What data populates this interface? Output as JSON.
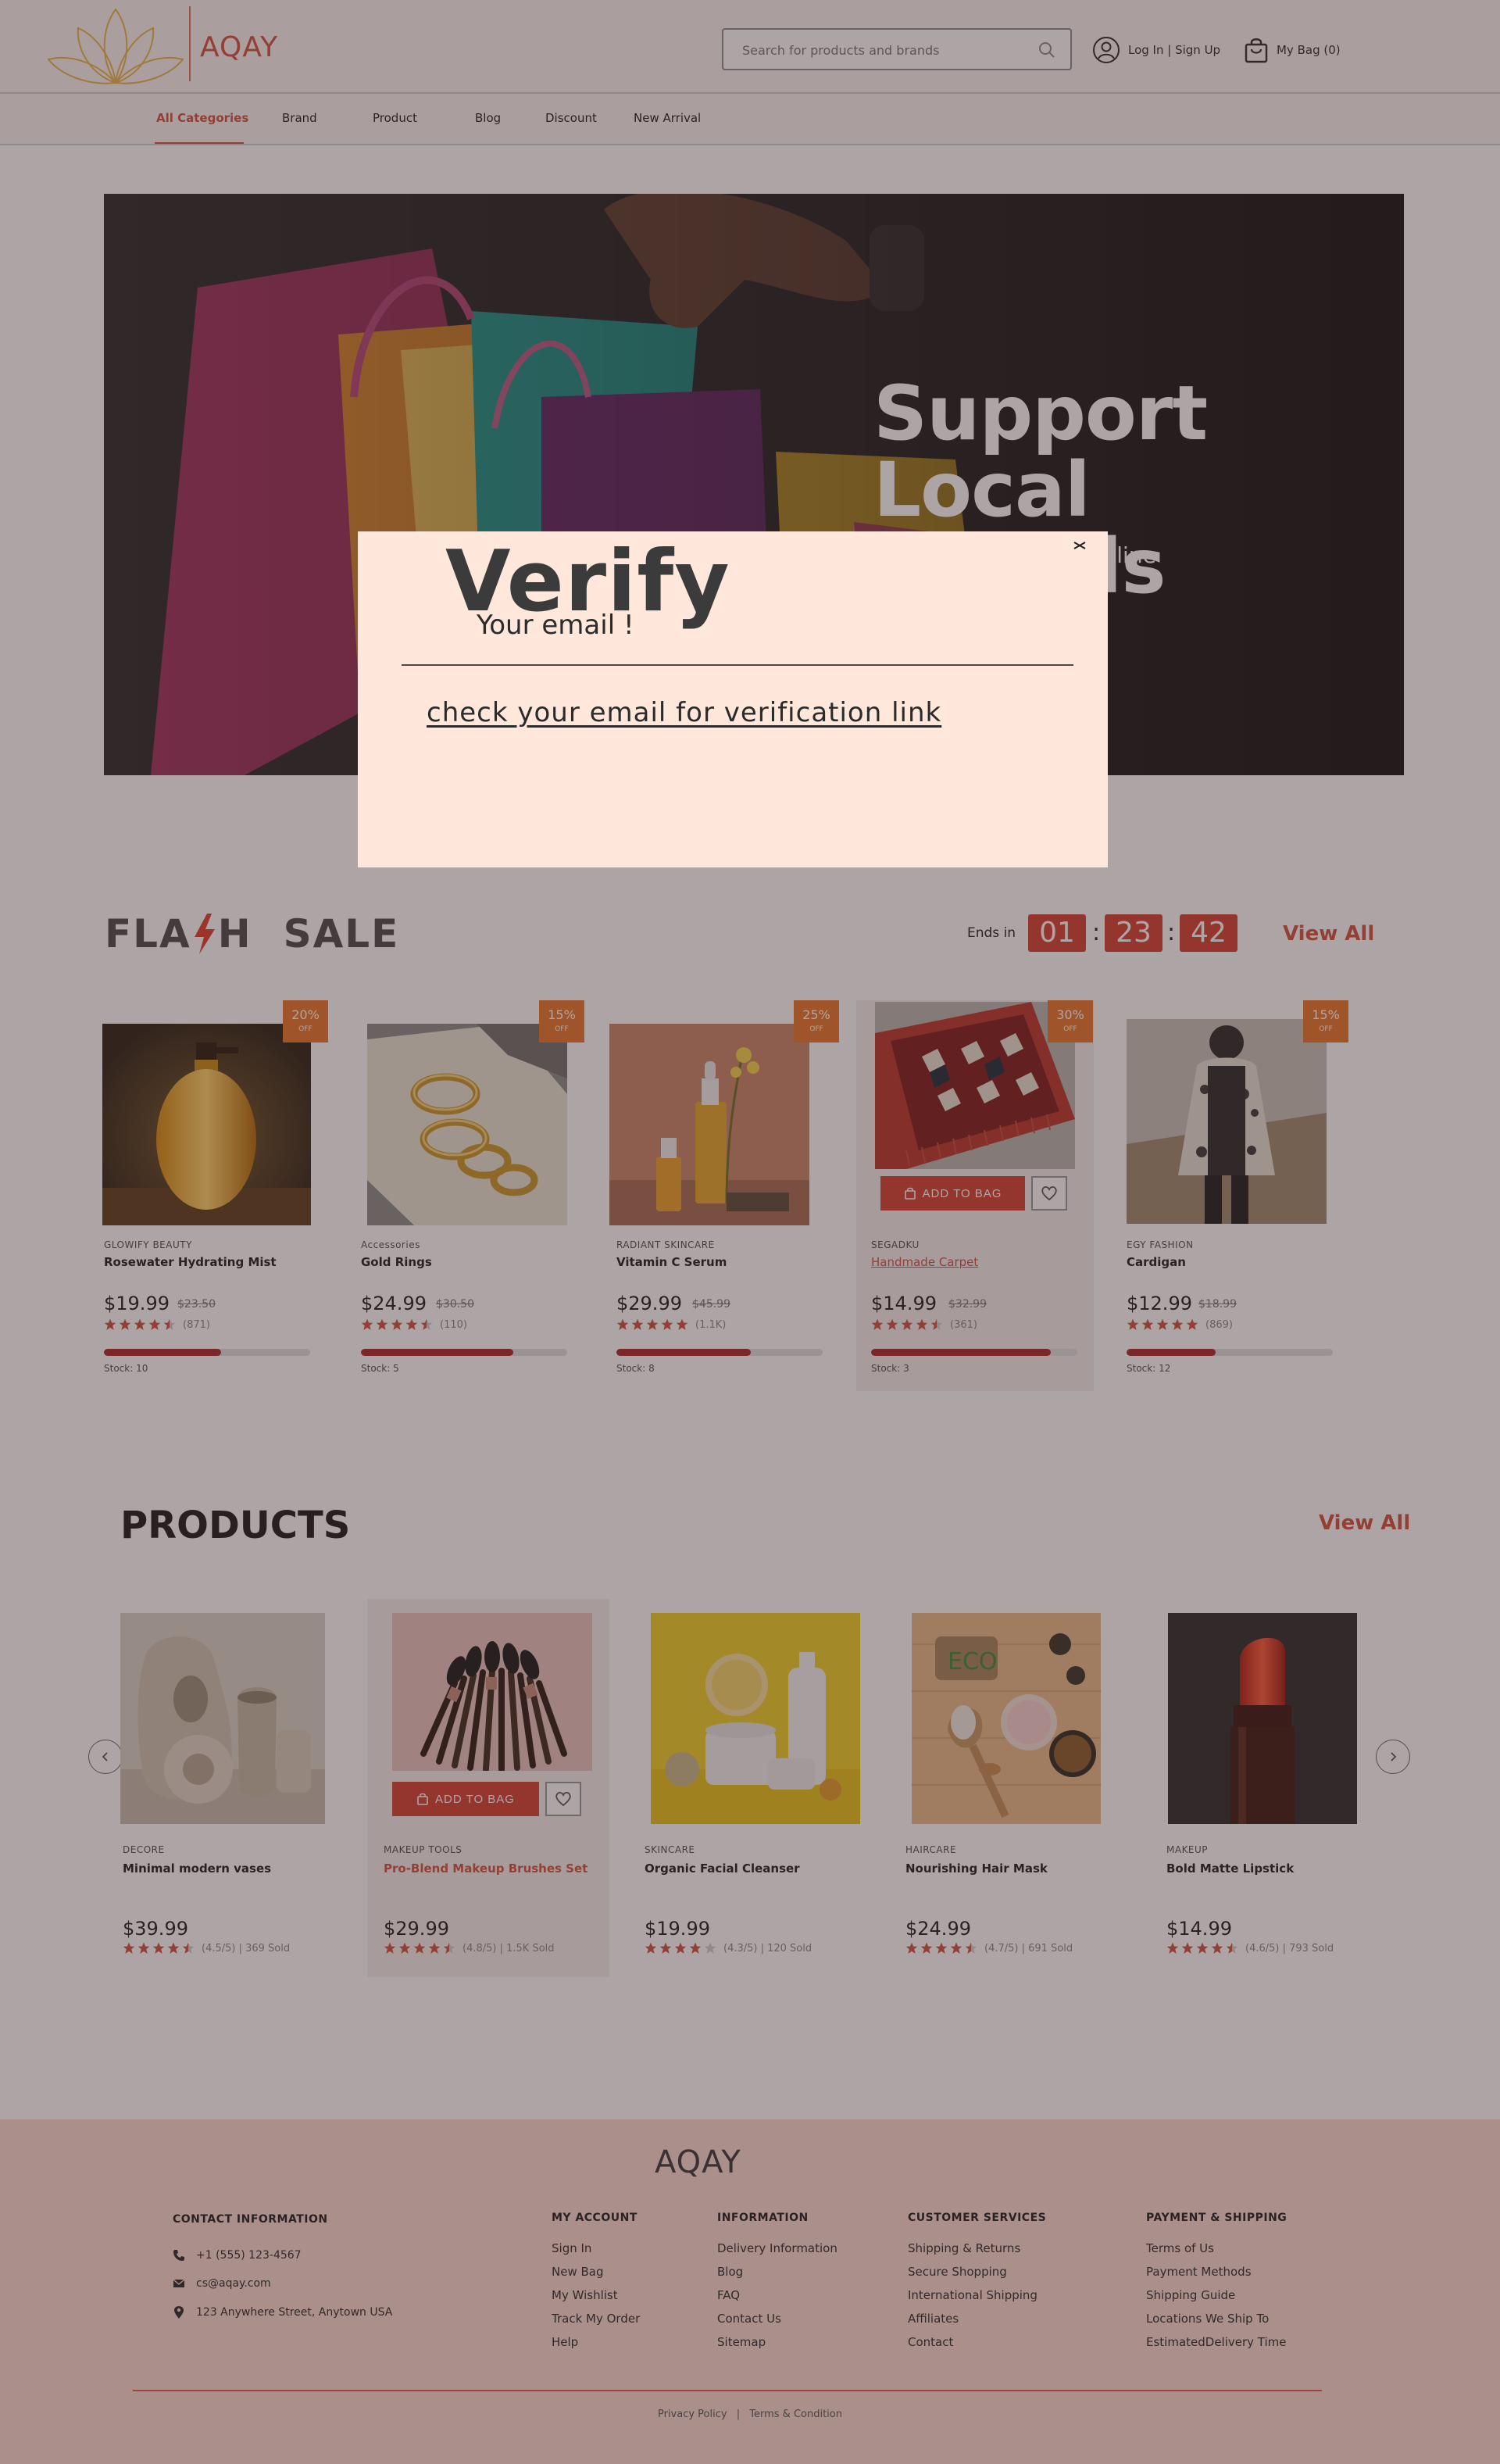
{
  "header": {
    "logo_text": "AQAY",
    "search_placeholder": "Search for products and brands",
    "account_label": "Log In | Sign Up",
    "bag_label": "My Bag (0)"
  },
  "nav": {
    "items": [
      "All Categories",
      "Brand",
      "Product",
      "Blog",
      "Discount",
      "New Arrival"
    ],
    "active": "All Categories"
  },
  "hero": {
    "title_line1": "Support",
    "title_line2": "Local Brands",
    "subtitle_visible": "s Online"
  },
  "flash_sale": {
    "title_part1": "FLA",
    "title_part2": "H",
    "title_part3": "SALE",
    "ends_in_label": "Ends in",
    "timer": [
      "01",
      "23",
      "42"
    ],
    "view_all": "View All",
    "add_to_bag_label": "ADD TO BAG",
    "products": [
      {
        "brand": "GLOWIFY BEAUTY",
        "name": "Rosewater Hydrating Mist",
        "price": "$19.99",
        "old_price": "$23.50",
        "rating_count": "(871)",
        "rating": 4.5,
        "discount": "20%",
        "discount_label": "OFF",
        "stock": "Stock: 10",
        "stock_level": 0.57
      },
      {
        "brand": "Accessories",
        "name": "Gold Rings",
        "price": "$24.99",
        "old_price": "$30.50",
        "rating_count": "(110)",
        "rating": 4.5,
        "discount": "15%",
        "discount_label": "OFF",
        "stock": "Stock: 5",
        "stock_level": 0.74
      },
      {
        "brand": "RADIANT SKINCARE",
        "name": "Vitamin C Serum",
        "price": "$29.99",
        "old_price": "$45.99",
        "rating_count": "(1.1K)",
        "rating": 5,
        "discount": "25%",
        "discount_label": "OFF",
        "stock": "Stock: 8",
        "stock_level": 0.65
      },
      {
        "brand": "SEGADKU",
        "name": "Handmade Carpet",
        "price": "$14.99",
        "old_price": "$32.99",
        "rating_count": "(361)",
        "rating": 4.5,
        "discount": "30%",
        "discount_label": "OFF",
        "stock": "Stock: 3",
        "stock_level": 0.87
      },
      {
        "brand": "EGY FASHION",
        "name": "Cardigan",
        "price": "$12.99",
        "old_price": "$18.99",
        "rating_count": "(869)",
        "rating": 5,
        "discount": "15%",
        "discount_label": "OFF",
        "stock": "Stock: 12",
        "stock_level": 0.43
      }
    ]
  },
  "products_section": {
    "title": "PRODUCTS",
    "view_all": "View All",
    "add_to_bag_label": "ADD TO BAG",
    "items": [
      {
        "category": "DECORE",
        "name": "Minimal modern vases",
        "price": "$39.99",
        "rating_text": "(4.5/5) | 369 Sold",
        "rating": 4.5
      },
      {
        "category": "MAKEUP TOOLS",
        "name": "Pro-Blend Makeup Brushes Set",
        "price": "$29.99",
        "rating_text": "(4.8/5) | 1.5K Sold",
        "rating": 4.5
      },
      {
        "category": "SKINCARE",
        "name": "Organic Facial Cleanser",
        "price": "$19.99",
        "rating_text": "(4.3/5) | 120 Sold",
        "rating": 4
      },
      {
        "category": "HAIRCARE",
        "name": "Nourishing Hair Mask",
        "price": "$24.99",
        "rating_text": "(4.7/5) | 691 Sold",
        "rating": 4.5
      },
      {
        "category": "MAKEUP",
        "name": "Bold Matte Lipstick",
        "price": "$14.99",
        "rating_text": "(4.6/5) | 793 Sold",
        "rating": 4.5
      }
    ],
    "haircare_tag": "ECO"
  },
  "footer": {
    "logo_text": "AQAY",
    "contact": {
      "heading": "CONTACT INFORMATION",
      "phone": "+1 (555) 123-4567",
      "email": "cs@aqay.com",
      "address": "123 Anywhere Street, Anytown USA"
    },
    "columns": [
      {
        "heading": "MY ACCOUNT",
        "links": [
          "Sign In",
          "New Bag",
          "My Wishlist",
          "Track My Order",
          "Help"
        ]
      },
      {
        "heading": "INFORMATION",
        "links": [
          "Delivery Information",
          "Blog",
          "FAQ",
          "Contact Us",
          "Sitemap"
        ]
      },
      {
        "heading": "CUSTOMER SERVICES",
        "links": [
          "Shipping & Returns",
          "Secure Shopping",
          "International Shipping",
          "Affiliates",
          "Contact"
        ]
      },
      {
        "heading": "PAYMENT & SHIPPING",
        "links": [
          "Terms of Us",
          "Payment Methods",
          "Shipping Guide",
          "Locations We Ship To",
          "EstimatedDelivery Time"
        ]
      }
    ],
    "bottom_privacy": "Privacy Policy",
    "bottom_separator": "|",
    "bottom_terms": "Terms & Condition"
  },
  "modal": {
    "title": "Verify",
    "subtitle": "Your email !",
    "message": "check your email for verification link"
  },
  "colors": {
    "accent": "#d2503e",
    "timer_bg": "#d43f33",
    "badge_bg": "#e8742b",
    "stock_fill": "#a8262a",
    "footer_bg": "#fbd9d3",
    "modal_bg": "#ffe7db"
  },
  "icons": [
    "lotus-logo-icon",
    "search-icon",
    "user-icon",
    "bag-icon",
    "bolt-icon",
    "heart-icon",
    "cart-icon",
    "star-icon",
    "chevron-left-icon",
    "chevron-right-icon",
    "phone-icon",
    "mail-icon",
    "location-icon",
    "close-icon"
  ]
}
